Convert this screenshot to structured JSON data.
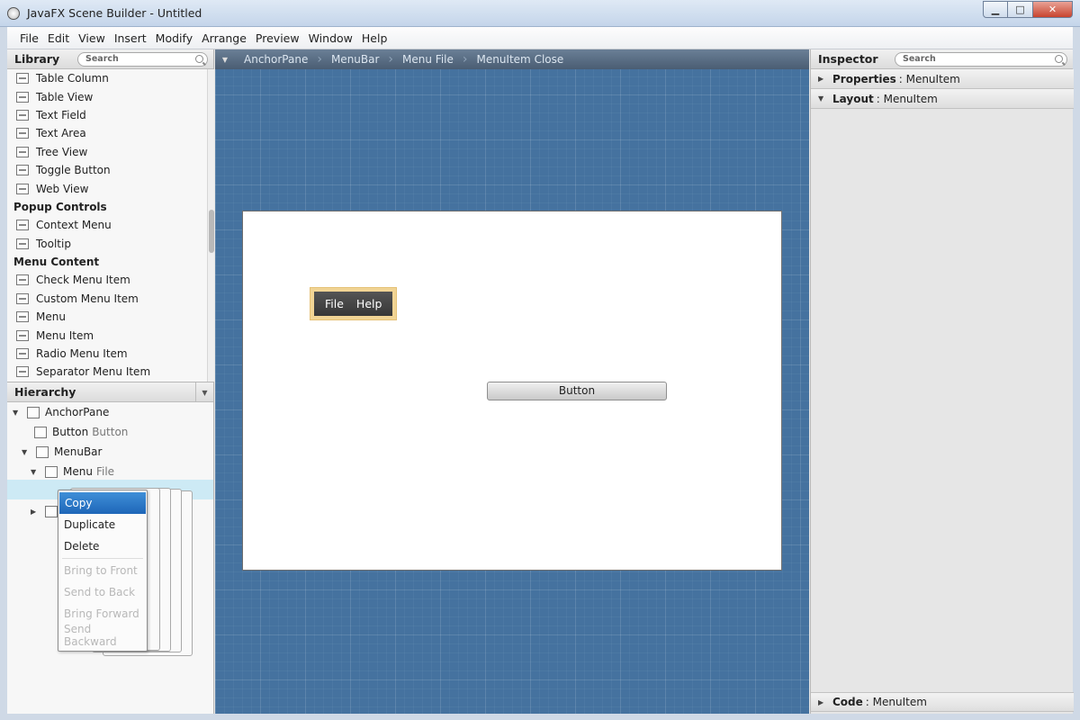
{
  "window": {
    "title": "JavaFX Scene Builder - Untitled",
    "minimize": "▁",
    "maximize": "□",
    "close": "✕"
  },
  "menubar": [
    "File",
    "Edit",
    "View",
    "Insert",
    "Modify",
    "Arrange",
    "Preview",
    "Window",
    "Help"
  ],
  "library": {
    "header": "Library",
    "search_placeholder": "Search",
    "rows": [
      {
        "kind": "item",
        "label": "Table Column"
      },
      {
        "kind": "item",
        "label": "Table View"
      },
      {
        "kind": "item",
        "label": "Text Field"
      },
      {
        "kind": "item",
        "label": "Text Area"
      },
      {
        "kind": "item",
        "label": "Tree View"
      },
      {
        "kind": "item",
        "label": "Toggle Button"
      },
      {
        "kind": "item",
        "label": "Web View"
      },
      {
        "kind": "category",
        "label": "Popup Controls"
      },
      {
        "kind": "item",
        "label": "Context Menu"
      },
      {
        "kind": "item",
        "label": "Tooltip"
      },
      {
        "kind": "category",
        "label": "Menu Content"
      },
      {
        "kind": "item",
        "label": "Check Menu Item"
      },
      {
        "kind": "item",
        "label": "Custom Menu Item"
      },
      {
        "kind": "item",
        "label": "Menu"
      },
      {
        "kind": "item",
        "label": "Menu Item"
      },
      {
        "kind": "item",
        "label": "Radio Menu Item"
      },
      {
        "kind": "item",
        "label": "Separator Menu Item"
      }
    ]
  },
  "hierarchy": {
    "header": "Hierarchy",
    "nodes": [
      {
        "label": "AnchorPane",
        "sub": "",
        "arrow": "▼"
      },
      {
        "label": "Button",
        "sub": "Button",
        "arrow": ""
      },
      {
        "label": "MenuBar",
        "sub": "",
        "arrow": "▼"
      },
      {
        "label": "Menu",
        "sub": "File",
        "arrow": "▼"
      }
    ]
  },
  "context_menu": {
    "items": [
      {
        "label": "Copy",
        "state": "active"
      },
      {
        "label": "Duplicate",
        "state": "enabled"
      },
      {
        "label": "Delete",
        "state": "enabled"
      },
      {
        "label": "Bring to Front",
        "state": "disabled"
      },
      {
        "label": "Send to Back",
        "state": "disabled"
      },
      {
        "label": "Bring Forward",
        "state": "disabled"
      },
      {
        "label": "Send Backward",
        "state": "disabled"
      }
    ]
  },
  "breadcrumb": [
    "AnchorPane",
    "MenuBar",
    "Menu File",
    "MenuItem Close"
  ],
  "stage": {
    "menubar_items": [
      "File",
      "Help"
    ],
    "button_label": "Button"
  },
  "inspector": {
    "header": "Inspector",
    "search_placeholder": "Search",
    "sections": [
      {
        "title": "Properties",
        "target": "MenuItem",
        "arrow": "▶"
      },
      {
        "title": "Layout",
        "target": "MenuItem",
        "arrow": "▼"
      }
    ],
    "code": {
      "title": "Code",
      "target": "MenuItem",
      "arrow": "▶"
    }
  },
  "colors": {
    "canvas": "#45729f",
    "selection": "#cdeaf5",
    "menubar_highlight": "#f1d28f",
    "menu_active": "#1e66b8"
  }
}
